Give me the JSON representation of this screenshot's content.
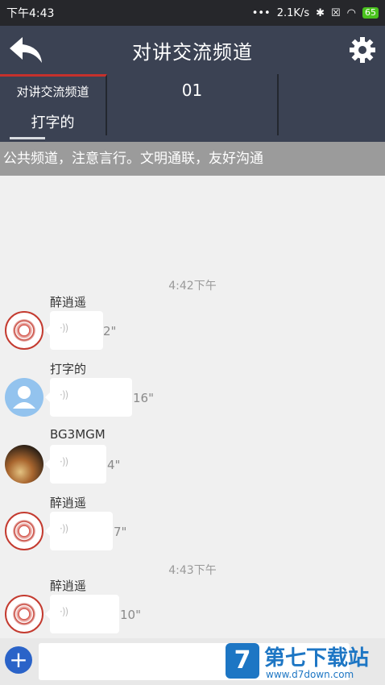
{
  "status": {
    "time": "下午4:43",
    "dots": "•••",
    "speed": "2.1K/s",
    "battery": "65"
  },
  "header": {
    "title": "对讲交流频道"
  },
  "channels": [
    {
      "name": "对讲交流频道",
      "sub": "打字的"
    },
    {
      "name": "01"
    },
    {
      "name": ""
    }
  ],
  "notice": "公共频道，注意言行。文明通联，友好沟通",
  "times": [
    "4:42下午",
    "4:43下午"
  ],
  "messages": [
    {
      "sender": "醉逍遥",
      "duration": "2\"",
      "avatar": "seal"
    },
    {
      "sender": "打字的",
      "duration": "16\"",
      "avatar": "default"
    },
    {
      "sender": "BG3MGM",
      "duration": "4\"",
      "avatar": "photo"
    },
    {
      "sender": "醉逍遥",
      "duration": "7\"",
      "avatar": "seal"
    },
    {
      "sender": "醉逍遥",
      "duration": "10\"",
      "avatar": "seal"
    }
  ],
  "input": {
    "value": ""
  },
  "watermark": {
    "title": "第七下载站",
    "url": "www.d7down.com"
  },
  "icons": {
    "back": "back-arrow-icon",
    "settings": "gear-icon",
    "add": "plus-circle-icon",
    "voice": "voice-wave-icon"
  }
}
